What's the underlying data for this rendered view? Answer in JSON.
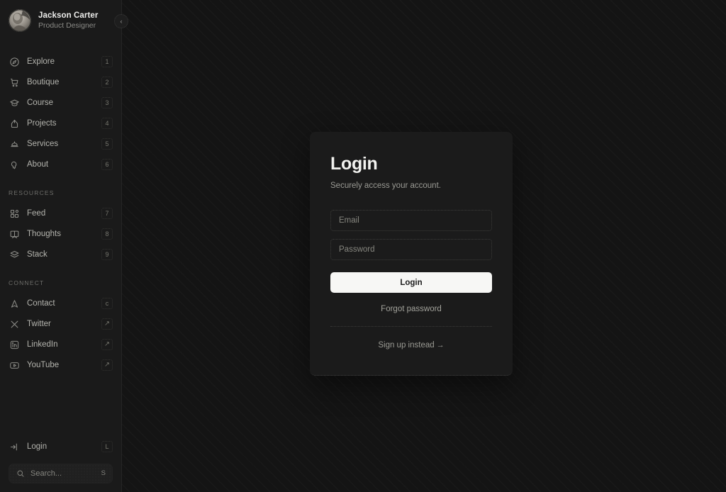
{
  "profile": {
    "name": "Jackson Carter",
    "role": "Product Designer",
    "avatar_icon": "user-avatar-photo"
  },
  "collapse_button": {
    "icon": "chevron-left-icon",
    "glyph": "‹"
  },
  "sidebar": {
    "primary_items": [
      {
        "label": "Explore",
        "key": "1",
        "icon": "compass-icon"
      },
      {
        "label": "Boutique",
        "key": "2",
        "icon": "shopping-cart-icon"
      },
      {
        "label": "Course",
        "key": "3",
        "icon": "graduation-cap-icon"
      },
      {
        "label": "Projects",
        "key": "4",
        "icon": "projects-icon"
      },
      {
        "label": "Services",
        "key": "5",
        "icon": "service-bell-icon"
      },
      {
        "label": "About",
        "key": "6",
        "icon": "lightbulb-icon"
      }
    ],
    "resources_label": "RESOURCES",
    "resources_items": [
      {
        "label": "Feed",
        "key": "7",
        "icon": "feed-grid-icon"
      },
      {
        "label": "Thoughts",
        "key": "8",
        "icon": "book-open-icon"
      },
      {
        "label": "Stack",
        "key": "9",
        "icon": "layers-icon"
      }
    ],
    "connect_label": "CONNECT",
    "connect_items": [
      {
        "label": "Contact",
        "key": "c",
        "icon": "paper-plane-icon"
      },
      {
        "label": "Twitter",
        "key": "↗",
        "icon": "x-twitter-icon"
      },
      {
        "label": "LinkedIn",
        "key": "↗",
        "icon": "linkedin-icon"
      },
      {
        "label": "YouTube",
        "key": "↗",
        "icon": "youtube-icon"
      }
    ],
    "login_item": {
      "label": "Login",
      "key": "L",
      "icon": "login-arrow-icon"
    },
    "search": {
      "placeholder": "Search...",
      "key": "S",
      "icon": "search-icon"
    }
  },
  "login_card": {
    "title": "Login",
    "subtitle": "Securely access your account.",
    "email_placeholder": "Email",
    "password_placeholder": "Password",
    "submit_label": "Login",
    "forgot_label": "Forgot password",
    "signup_label": "Sign up instead",
    "signup_arrow": "→"
  },
  "colors": {
    "page_background": "#141414",
    "sidebar_background": "#1a1a1a",
    "card_background": "#1b1b1b",
    "primary_button": "#f7f7f5",
    "text_primary": "#f2f2ef",
    "text_muted": "#9a9a94"
  }
}
